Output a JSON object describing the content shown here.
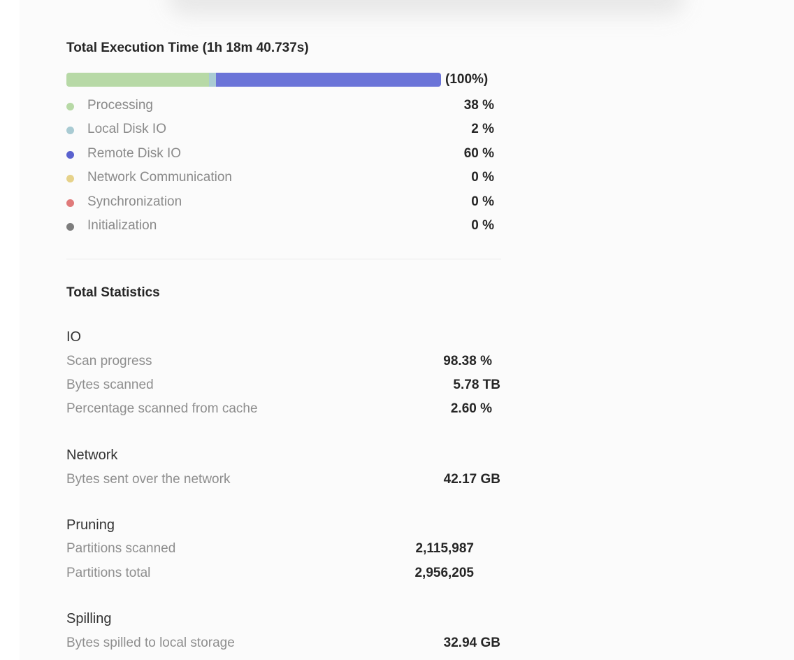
{
  "execution": {
    "title": "Total Execution Time (1h 18m 40.737s)",
    "bar_total_label": "(100%)",
    "bar_segments": [
      {
        "name": "Processing",
        "fraction": 0.38,
        "color": "#b7d9a6"
      },
      {
        "name": "Local Disk IO",
        "fraction": 0.02,
        "color": "#a9cbd3"
      },
      {
        "name": "Remote Disk IO",
        "fraction": 0.6,
        "color": "#6b74d8"
      }
    ],
    "legend": [
      {
        "label": "Processing",
        "value": "38 %",
        "color": "#b7d9a6"
      },
      {
        "label": "Local Disk IO",
        "value": "2 %",
        "color": "#a9cbd3"
      },
      {
        "label": "Remote Disk IO",
        "value": "60 %",
        "color": "#5a62cf"
      },
      {
        "label": "Network Communication",
        "value": "0 %",
        "color": "#e6d28a"
      },
      {
        "label": "Synchronization",
        "value": "0 %",
        "color": "#e07a7a"
      },
      {
        "label": "Initialization",
        "value": "0 %",
        "color": "#7d7d7d"
      }
    ]
  },
  "statistics": {
    "title": "Total Statistics",
    "io": {
      "title": "IO",
      "scan_progress": {
        "label": "Scan progress",
        "value": "98.38 %"
      },
      "bytes_scanned": {
        "label": "Bytes scanned",
        "value": "5.78 TB"
      },
      "pct_from_cache": {
        "label": "Percentage scanned from cache",
        "value": "2.60 %"
      }
    },
    "network": {
      "title": "Network",
      "bytes_sent": {
        "label": "Bytes sent over the network",
        "value": "42.17 GB"
      }
    },
    "pruning": {
      "title": "Pruning",
      "partitions_scanned": {
        "label": "Partitions scanned",
        "value": "2,115,987"
      },
      "partitions_total": {
        "label": "Partitions total",
        "value": "2,956,205"
      }
    },
    "spilling": {
      "title": "Spilling",
      "bytes_spilled": {
        "label": "Bytes spilled to local storage",
        "value": "32.94 GB"
      }
    }
  }
}
